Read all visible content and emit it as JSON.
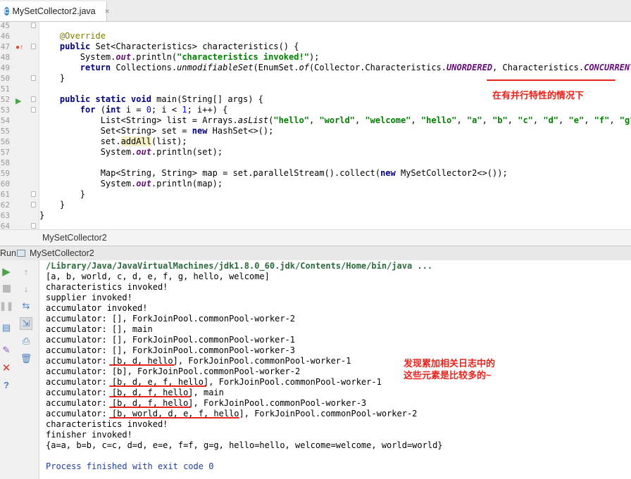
{
  "tab": {
    "icon_letter": "C",
    "title": "MySetCollector2.java",
    "close": "×"
  },
  "editor": {
    "lines": [
      {
        "n": "45",
        "segs": []
      },
      {
        "n": "46",
        "segs": [
          {
            "t": "    "
          },
          {
            "t": "@Override",
            "c": "ann"
          }
        ]
      },
      {
        "n": "47",
        "segs": [
          {
            "t": "    "
          },
          {
            "t": "public",
            "c": "kw"
          },
          {
            "t": " Set<Characteristics> characteristics() {"
          }
        ]
      },
      {
        "n": "48",
        "segs": [
          {
            "t": "        System."
          },
          {
            "t": "out",
            "c": "fld"
          },
          {
            "t": ".println("
          },
          {
            "t": "\"characteristics invoked!\"",
            "c": "str"
          },
          {
            "t": ");"
          }
        ]
      },
      {
        "n": "49",
        "segs": [
          {
            "t": "        "
          },
          {
            "t": "return",
            "c": "kw"
          },
          {
            "t": " Collections."
          },
          {
            "t": "unmodifiableSet",
            "c": "it"
          },
          {
            "t": "(EnumSet."
          },
          {
            "t": "of",
            "c": "it"
          },
          {
            "t": "(Collector.Characteristics."
          },
          {
            "t": "UNORDERED",
            "c": "fld"
          },
          {
            "t": ", Characteristics."
          },
          {
            "t": "CONCURRENT",
            "c": "fld"
          },
          {
            "t": "));"
          }
        ]
      },
      {
        "n": "50",
        "segs": [
          {
            "t": "    }"
          }
        ]
      },
      {
        "n": "51",
        "segs": []
      },
      {
        "n": "52",
        "segs": [
          {
            "t": "    "
          },
          {
            "t": "public static void",
            "c": "kw"
          },
          {
            "t": " main(String[] args) {"
          }
        ]
      },
      {
        "n": "53",
        "segs": [
          {
            "t": "        "
          },
          {
            "t": "for",
            "c": "kw"
          },
          {
            "t": " ("
          },
          {
            "t": "int",
            "c": "kw"
          },
          {
            "t": " i = "
          },
          {
            "t": "0",
            "c": "num"
          },
          {
            "t": "; i < "
          },
          {
            "t": "1",
            "c": "num"
          },
          {
            "t": "; i++) {"
          }
        ]
      },
      {
        "n": "54",
        "segs": [
          {
            "t": "            List<String> list = Arrays."
          },
          {
            "t": "asList",
            "c": "it"
          },
          {
            "t": "("
          },
          {
            "t": "\"hello\"",
            "c": "str"
          },
          {
            "t": ", "
          },
          {
            "t": "\"world\"",
            "c": "str"
          },
          {
            "t": ", "
          },
          {
            "t": "\"welcome\"",
            "c": "str"
          },
          {
            "t": ", "
          },
          {
            "t": "\"hello\"",
            "c": "str"
          },
          {
            "t": ", "
          },
          {
            "t": "\"a\"",
            "c": "str"
          },
          {
            "t": ", "
          },
          {
            "t": "\"b\"",
            "c": "str"
          },
          {
            "t": ", "
          },
          {
            "t": "\"c\"",
            "c": "str"
          },
          {
            "t": ", "
          },
          {
            "t": "\"d\"",
            "c": "str"
          },
          {
            "t": ", "
          },
          {
            "t": "\"e\"",
            "c": "str"
          },
          {
            "t": ", "
          },
          {
            "t": "\"f\"",
            "c": "str"
          },
          {
            "t": ", "
          },
          {
            "t": "\"g\"",
            "c": "str"
          },
          {
            "t": ");"
          }
        ]
      },
      {
        "n": "55",
        "segs": [
          {
            "t": "            Set<String> set = "
          },
          {
            "t": "new",
            "c": "kw"
          },
          {
            "t": " HashSet<>();"
          }
        ]
      },
      {
        "n": "56",
        "segs": [
          {
            "t": "            set."
          },
          {
            "t": "addAll",
            "c": "hl"
          },
          {
            "t": "(list);"
          }
        ]
      },
      {
        "n": "57",
        "segs": [
          {
            "t": "            System."
          },
          {
            "t": "out",
            "c": "fld"
          },
          {
            "t": ".println(set);"
          }
        ]
      },
      {
        "n": "58",
        "segs": []
      },
      {
        "n": "59",
        "segs": [
          {
            "t": "            Map<String, String> map = set.parallelStream().collect("
          },
          {
            "t": "new",
            "c": "kw"
          },
          {
            "t": " MySetCollector2<>());"
          }
        ]
      },
      {
        "n": "60",
        "segs": [
          {
            "t": "            System."
          },
          {
            "t": "out",
            "c": "fld"
          },
          {
            "t": ".println(map);"
          }
        ]
      },
      {
        "n": "61",
        "segs": [
          {
            "t": "        }"
          }
        ]
      },
      {
        "n": "62",
        "segs": [
          {
            "t": "    }"
          }
        ]
      },
      {
        "n": "63",
        "segs": [
          {
            "t": "}"
          }
        ]
      },
      {
        "n": "64",
        "segs": []
      }
    ]
  },
  "breadcrumb": "MySetCollector2",
  "run_header": {
    "label": "Run",
    "config": "MySetCollector2"
  },
  "console": {
    "lines": [
      {
        "t": "/Library/Java/JavaVirtualMachines/jdk1.8.0_60.jdk/Contents/Home/bin/java ...",
        "c": "path"
      },
      {
        "t": "[a, b, world, c, d, e, f, g, hello, welcome]"
      },
      {
        "t": "characteristics invoked!"
      },
      {
        "t": "supplier invoked!"
      },
      {
        "t": "accumulator invoked!"
      },
      {
        "t": "accumulator: [], ForkJoinPool.commonPool-worker-2"
      },
      {
        "t": "accumulator: [], main"
      },
      {
        "t": "accumulator: [], ForkJoinPool.commonPool-worker-1"
      },
      {
        "t": "accumulator: [], ForkJoinPool.commonPool-worker-3"
      },
      {
        "t": "accumulator: [b, d, hello], ForkJoinPool.commonPool-worker-1"
      },
      {
        "t": "accumulator: [b], ForkJoinPool.commonPool-worker-2"
      },
      {
        "t": "accumulator: [b, d, e, f, hello], ForkJoinPool.commonPool-worker-1"
      },
      {
        "t": "accumulator: [b, d, f, hello], main"
      },
      {
        "t": "accumulator: [b, d, f, hello], ForkJoinPool.commonPool-worker-3"
      },
      {
        "t": "accumulator: [b, world, d, e, f, hello], ForkJoinPool.commonPool-worker-2"
      },
      {
        "t": "characteristics invoked!"
      },
      {
        "t": "finisher invoked!"
      },
      {
        "t": "{a=a, b=b, c=c, d=d, e=e, f=f, g=g, hello=hello, welcome=welcome, world=world}"
      },
      {
        "t": ""
      },
      {
        "t": "Process finished with exit code 0",
        "c": "blue"
      }
    ]
  },
  "annotations": {
    "note1": "在有并行特性的情况下",
    "note2_line1": "发现累加相关日志中的",
    "note2_line2": "这些元素是比较多的~"
  },
  "colors": {
    "annotation_red": "#e8231b"
  }
}
